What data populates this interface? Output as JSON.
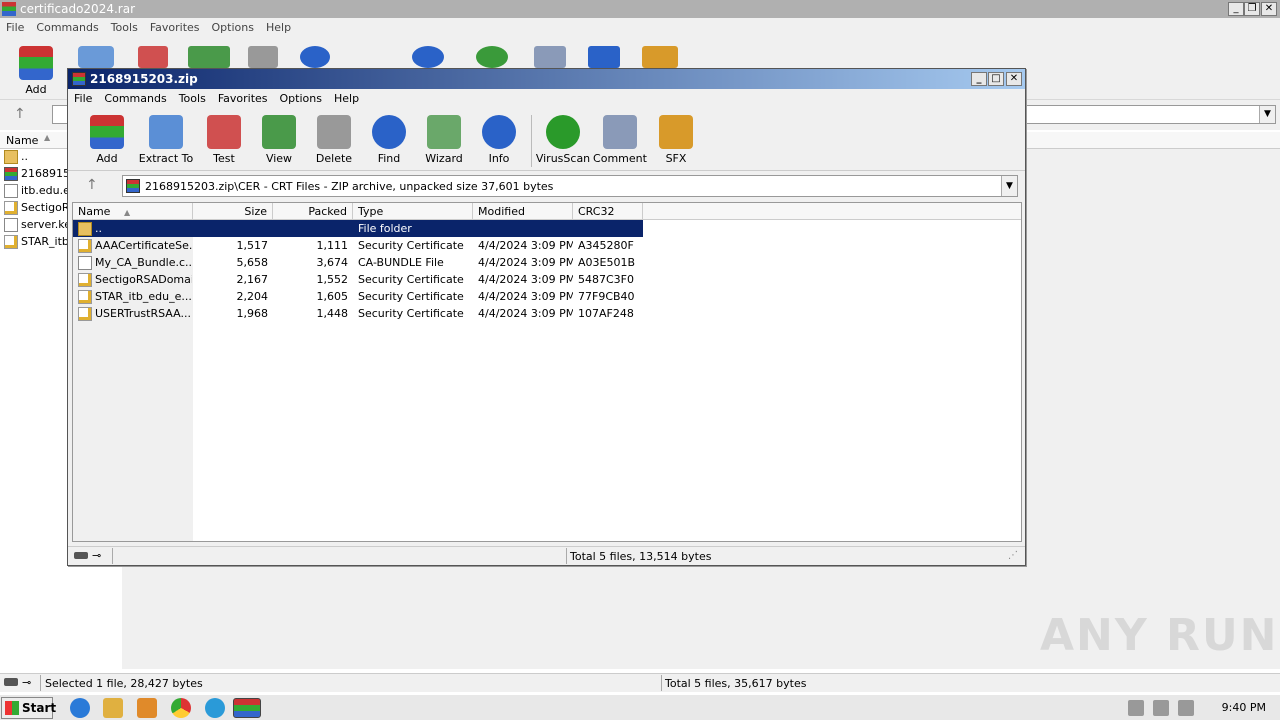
{
  "background_window": {
    "title": "certificado2024.rar",
    "menu": [
      "File",
      "Commands",
      "Tools",
      "Favorites",
      "Options",
      "Help"
    ],
    "toolbar_first_label": "Add",
    "column_name": "Name",
    "files": [
      "..",
      "2168915",
      "itb.edu.e",
      "SectigoR",
      "server.ke",
      "STAR_itb"
    ],
    "status_left": "Selected 1 file, 28,427 bytes",
    "status_right": "Total 5 files, 35,617 bytes"
  },
  "window": {
    "title": "2168915203.zip",
    "menu": [
      "File",
      "Commands",
      "Tools",
      "Favorites",
      "Options",
      "Help"
    ],
    "toolbar": [
      {
        "label": "Add",
        "icon": "add-archive-icon",
        "color": "#3a8a3a"
      },
      {
        "label": "Extract To",
        "icon": "extract-folder-icon",
        "color": "#3b7fd4"
      },
      {
        "label": "Test",
        "icon": "test-clipboard-icon",
        "color": "#c83a3a"
      },
      {
        "label": "View",
        "icon": "view-book-icon",
        "color": "#3a9a3a"
      },
      {
        "label": "Delete",
        "icon": "trash-icon",
        "color": "#8a8a8a"
      },
      {
        "label": "Find",
        "icon": "magnifier-icon",
        "color": "#2a62c8"
      },
      {
        "label": "Wizard",
        "icon": "magic-wand-icon",
        "color": "#5aa05a"
      },
      {
        "label": "Info",
        "icon": "info-icon",
        "color": "#2a62c8"
      },
      {
        "label": "VirusScan",
        "icon": "virus-scan-icon",
        "color": "#2a9a2a"
      },
      {
        "label": "Comment",
        "icon": "comment-icon",
        "color": "#7a8aa8"
      },
      {
        "label": "SFX",
        "icon": "sfx-box-icon",
        "color": "#d89a2a"
      }
    ],
    "address": "2168915203.zip\\CER - CRT Files - ZIP archive, unpacked size 37,601 bytes",
    "columns": [
      "Name",
      "Size",
      "Packed",
      "Type",
      "Modified",
      "CRC32"
    ],
    "rows": [
      {
        "name": "..",
        "size": "",
        "packed": "",
        "type": "File folder",
        "modified": "",
        "crc": "",
        "icon": "folder",
        "selected": true
      },
      {
        "name": "AAACertificateSe...",
        "size": "1,517",
        "packed": "1,111",
        "type": "Security Certificate",
        "modified": "4/4/2024 3:09 PM",
        "crc": "A345280F",
        "icon": "cert",
        "selected": false
      },
      {
        "name": "My_CA_Bundle.c...",
        "size": "5,658",
        "packed": "3,674",
        "type": "CA-BUNDLE File",
        "modified": "4/4/2024 3:09 PM",
        "crc": "A03E501B",
        "icon": "file",
        "selected": false
      },
      {
        "name": "SectigoRSADomai...",
        "size": "2,167",
        "packed": "1,552",
        "type": "Security Certificate",
        "modified": "4/4/2024 3:09 PM",
        "crc": "5487C3F0",
        "icon": "cert",
        "selected": false
      },
      {
        "name": "STAR_itb_edu_e...",
        "size": "2,204",
        "packed": "1,605",
        "type": "Security Certificate",
        "modified": "4/4/2024 3:09 PM",
        "crc": "77F9CB40",
        "icon": "cert",
        "selected": false
      },
      {
        "name": "USERTrustRSAA...",
        "size": "1,968",
        "packed": "1,448",
        "type": "Security Certificate",
        "modified": "4/4/2024 3:09 PM",
        "crc": "107AF248",
        "icon": "cert",
        "selected": false
      }
    ],
    "status": "Total 5 files, 13,514 bytes"
  },
  "taskbar": {
    "start_label": "Start",
    "clock": "9:40 PM"
  },
  "watermark": "ANY RUN"
}
